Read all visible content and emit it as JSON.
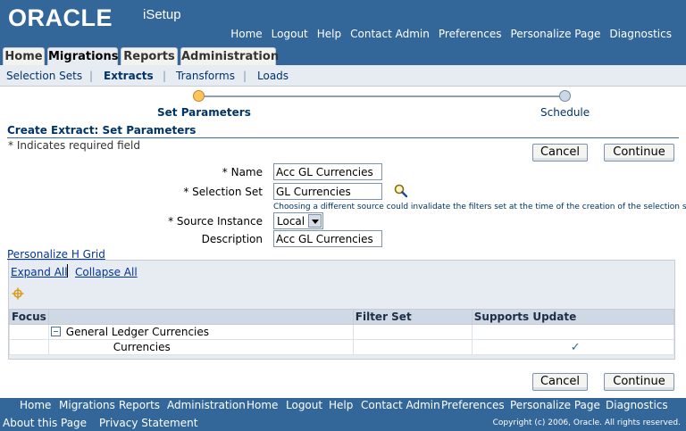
{
  "branding": {
    "logo": "ORACLE",
    "app_name": "iSetup"
  },
  "global_links": [
    "Home",
    "Logout",
    "Help",
    "Contact Admin",
    "Preferences",
    "Personalize Page",
    "Diagnostics"
  ],
  "tabs": [
    {
      "label": "Home",
      "active": false
    },
    {
      "label": "Migrations",
      "active": true
    },
    {
      "label": "Reports",
      "active": false
    },
    {
      "label": "Administration",
      "active": false
    }
  ],
  "subtabs": [
    {
      "label": "Selection Sets",
      "active": false
    },
    {
      "label": "Extracts",
      "active": true
    },
    {
      "label": "Transforms",
      "active": false
    },
    {
      "label": "Loads",
      "active": false
    }
  ],
  "train": {
    "steps": [
      "Set Parameters",
      "Schedule"
    ],
    "current_step": 1
  },
  "page": {
    "header": "Create Extract: Set Parameters",
    "required_note": "* Indicates required field"
  },
  "buttons": {
    "cancel": "Cancel",
    "continue": "Continue"
  },
  "form": {
    "name_label": "* Name",
    "name_value": "Acc GL Currencies",
    "selection_set_label": "* Selection Set",
    "selection_set_value": "GL Currencies",
    "hint": "Choosing a different source could invalidate the filters set at the time of the creation of the selection set.",
    "source_instance_label": "* Source Instance",
    "source_instance_value": "Local",
    "description_label": "Description",
    "description_value": "Acc GL Currencies"
  },
  "grid": {
    "personalize_link": "Personalize H Grid",
    "expand_all": "Expand All",
    "collapse_all": "Collapse All",
    "columns": [
      "Focus",
      "",
      "Filter Set",
      "Supports Update"
    ],
    "rows": [
      {
        "label": "General Ledger Currencies",
        "filter_set": "",
        "supports_update": false,
        "expandable": true
      },
      {
        "label": "Currencies",
        "filter_set": "",
        "supports_update": true,
        "expandable": false
      }
    ],
    "check_mark": "✓"
  },
  "footer": {
    "links": [
      "Home",
      "Migrations",
      "Reports",
      "Administration",
      "Home",
      "Logout",
      "Help",
      "Contact Admin",
      "Preferences",
      "Personalize Page",
      "Diagnostics"
    ],
    "about": "About this Page",
    "privacy": "Privacy Statement",
    "copyright": "Copyright (c) 2006, Oracle. All rights reserved."
  },
  "colors": {
    "brand_blue": "#336699",
    "tab_bg": "#e7ecf3",
    "train_active": "#fdc65c"
  }
}
